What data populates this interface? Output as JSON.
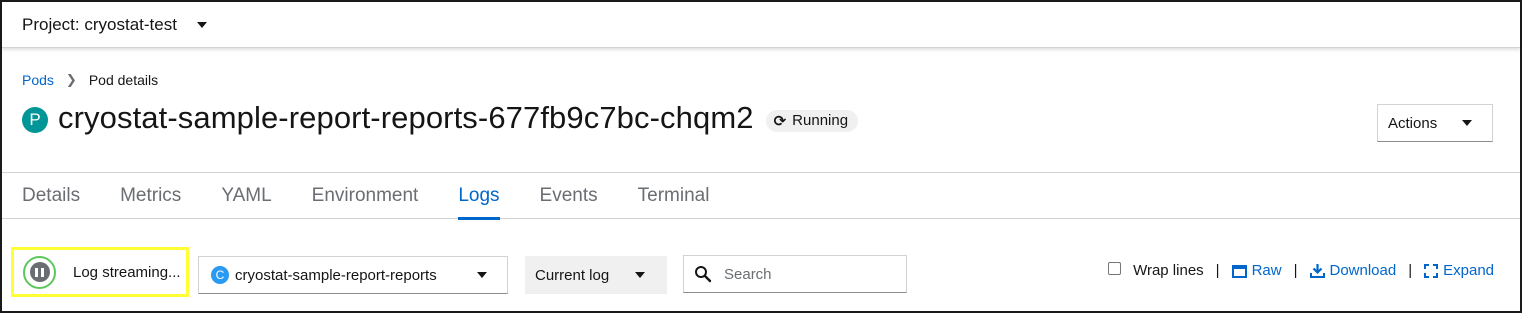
{
  "project": {
    "label": "Project: cryostat-test"
  },
  "breadcrumb": {
    "parent": "Pods",
    "current": "Pod details"
  },
  "pod": {
    "badge": "P",
    "name": "cryostat-sample-report-reports-677fb9c7bc-chqm2",
    "status": "Running"
  },
  "actions": {
    "label": "Actions"
  },
  "tabs": [
    "Details",
    "Metrics",
    "YAML",
    "Environment",
    "Logs",
    "Events",
    "Terminal"
  ],
  "active_tab": "Logs",
  "toolbar": {
    "streaming_label": "Log streaming...",
    "container_badge": "C",
    "container": "cryostat-sample-report-reports",
    "log_type": "Current log",
    "search_placeholder": "Search",
    "wrap_lines": "Wrap lines",
    "wrap_checked": false,
    "separator": "|",
    "raw": "Raw",
    "download": "Download",
    "expand": "Expand"
  },
  "colors": {
    "link": "#0066cc",
    "pod_badge": "#009596",
    "container_badge": "#2b9af3",
    "highlight": "#ffff33",
    "pause_ring": "#5cc85c"
  }
}
